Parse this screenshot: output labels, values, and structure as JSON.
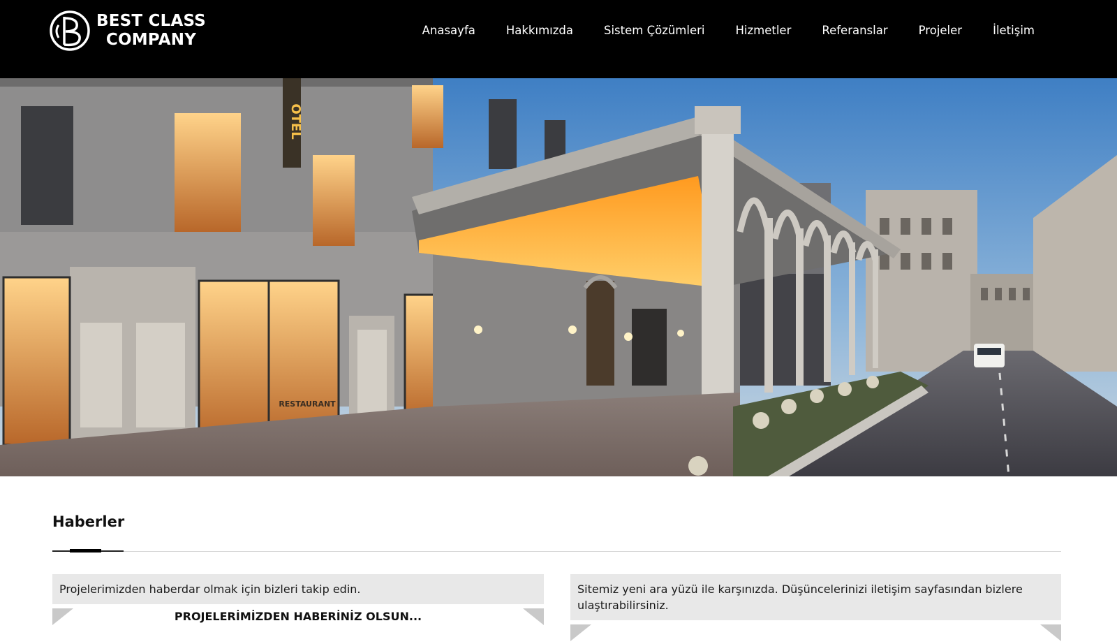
{
  "brand": {
    "line1": "BEST CLASS",
    "line2": "COMPANY",
    "logo_icon": "bc-monogram-icon"
  },
  "nav": {
    "items": [
      {
        "label": "Anasayfa"
      },
      {
        "label": "Hakkımızda"
      },
      {
        "label": "Sistem Çözümleri"
      },
      {
        "label": "Hizmetler"
      },
      {
        "label": "Referanslar"
      },
      {
        "label": "Projeler"
      },
      {
        "label": "İletişim"
      }
    ]
  },
  "hero": {
    "image": "hotel-street-night-render",
    "sign_text": "OTEL",
    "restaurant_text": "RESTAURANT"
  },
  "news": {
    "title": "Haberler",
    "cards": [
      {
        "text": "Projelerimizden haberdar olmak için bizleri takip edin.",
        "heading": "PROJELERİMİZDEN HABERİNİZ OLSUN..."
      },
      {
        "text": "Sitemiz yeni ara yüzü ile karşınızda. Düşüncelerinizi iletişim sayfasından bizlere ulaştırabilirsiniz.",
        "heading": ""
      }
    ]
  },
  "colors": {
    "header_bg": "#000000",
    "card_bg": "#e8e8e8",
    "accent": "#000000"
  }
}
